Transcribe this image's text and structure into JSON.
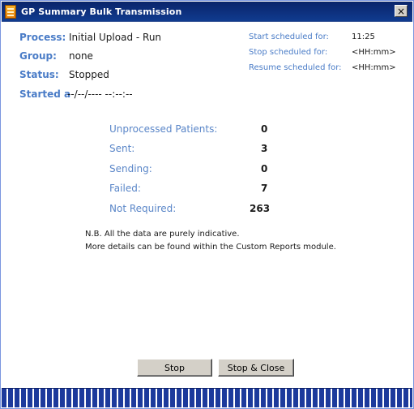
{
  "window": {
    "title": "GP Summary Bulk Transmission",
    "close_glyph": "×"
  },
  "info": {
    "process_label": "Process:",
    "process_value": "Initial Upload - Run",
    "group_label": "Group:",
    "group_value": "none",
    "status_label": "Status:",
    "status_value": "Stopped",
    "started_label": "Started a",
    "started_value": "--/--/---- --:--:--"
  },
  "schedule": {
    "start_label": "Start scheduled for:",
    "start_value": "11:25",
    "stop_label": "Stop scheduled for:",
    "stop_value": "<HH:mm>",
    "resume_label": "Resume scheduled for:",
    "resume_value": "<HH:mm>"
  },
  "stats": [
    {
      "label": "Unprocessed Patients:",
      "value": "0"
    },
    {
      "label": "Sent:",
      "value": "3"
    },
    {
      "label": "Sending:",
      "value": "0"
    },
    {
      "label": "Failed:",
      "value": "7"
    },
    {
      "label": "Not Required:",
      "value": "263"
    }
  ],
  "note": {
    "line1": "N.B. All the data are purely indicative.",
    "line2": "More details can be found within the Custom Reports module."
  },
  "buttons": {
    "stop": "Stop",
    "stop_close": "Stop & Close"
  },
  "colors": {
    "label_blue": "#4a7cc7",
    "title_bar": "#0a246a",
    "progress_blue": "#1c3a9c"
  },
  "icons": {
    "app": "app-icon",
    "close": "close-icon"
  }
}
